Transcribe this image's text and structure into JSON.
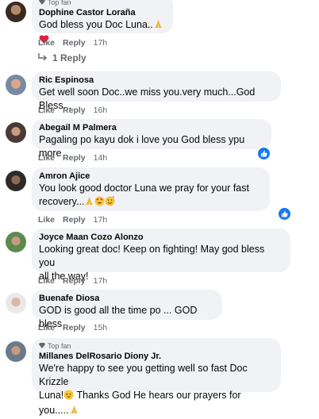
{
  "comments": [
    {
      "badge": "Top fan",
      "name": "Dophine Castor Loraña",
      "text": "God bless you Doc Luna..",
      "emojis": [
        "hands-icon",
        "heart-icon"
      ],
      "like": "Like",
      "reply": "Reply",
      "time": "17h"
    },
    {
      "name": "Ric Espinosa",
      "text": "Get well soon Doc..we miss you.very much...God Bless...",
      "like": "Like",
      "reply": "Reply",
      "time": "16h"
    },
    {
      "name": "Abegail M Palmera",
      "text": "Pagaling po kayu dok i love you God bless ypu more",
      "like": "Like",
      "reply": "Reply",
      "time": "14h"
    },
    {
      "name": "Amron Ajice",
      "text_line1": "You look good doctor Luna we pray for your fast",
      "text_line2": "recovery...",
      "like": "Like",
      "reply": "Reply",
      "time": "17h"
    },
    {
      "name": "Joyce Maan Cozo Alonzo",
      "text_line1": "Looking great doc! Keep on fighting! May god bless you",
      "text_line2": "all the way!",
      "like": "Like",
      "reply": "Reply",
      "time": "17h"
    },
    {
      "name": "Buenafe Diosa",
      "text": "GOD is good all the time po ... GOD bless",
      "like": "Like",
      "reply": "Reply",
      "time": "15h"
    },
    {
      "badge": "Top fan",
      "name": "Millanes DelRosario Diony Jr.",
      "text_line1": "We're happy to see you getting well so fast Doc Krizzle",
      "text_line2a": "Luna!",
      "text_line2b": " Thanks God He hears our prayers for you.....",
      "like": "Like",
      "reply": "Reply"
    }
  ],
  "replies_link": "1 Reply",
  "colors": {
    "bubble": "#f0f2f5",
    "accent": "#1877f2",
    "muted": "#65676b"
  }
}
